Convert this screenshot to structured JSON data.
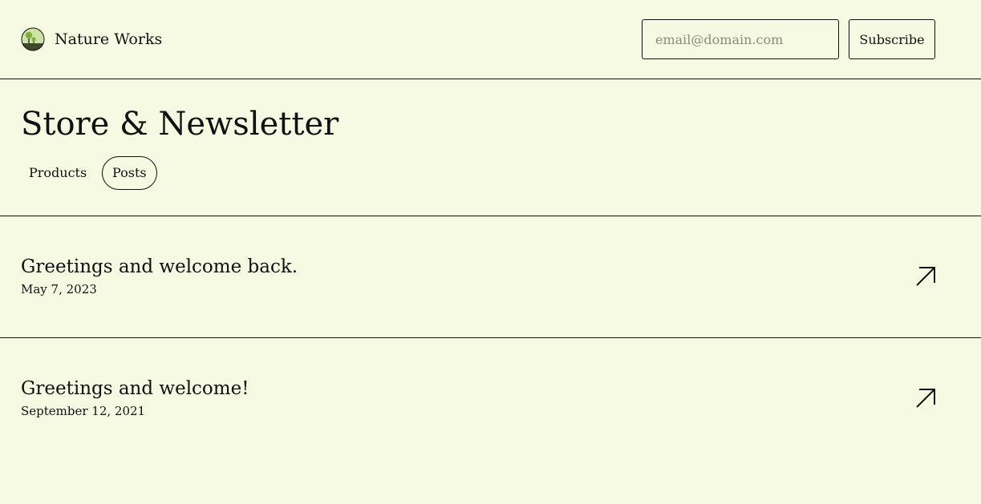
{
  "header": {
    "brand_name": "Nature Works",
    "logo_icon": "nature-logo-icon",
    "email_placeholder": "email@domain.com",
    "email_value": "",
    "subscribe_label": "Subscribe"
  },
  "hero": {
    "title": "Store & Newsletter",
    "tabs": [
      {
        "label": "Products",
        "active": false
      },
      {
        "label": "Posts",
        "active": true
      }
    ]
  },
  "posts": [
    {
      "title": "Greetings and welcome back.",
      "date": "May 7, 2023",
      "icon": "arrow-up-right-icon"
    },
    {
      "title": "Greetings and welcome!",
      "date": "September 12, 2021",
      "icon": "arrow-up-right-icon"
    }
  ],
  "colors": {
    "background": "#f7fae3",
    "text": "#111111",
    "logo_green": "#7fae3e",
    "logo_ground": "#3f4a2a"
  }
}
